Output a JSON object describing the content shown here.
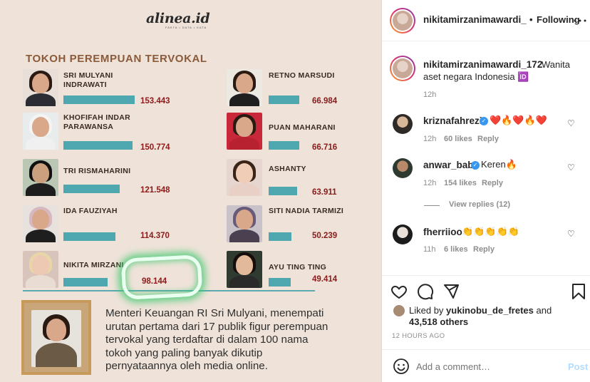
{
  "post_image": {
    "brand": "alinea.id",
    "brand_tagline": "FAKTA • DATA • KATA",
    "headline": "TOKOH PEREMPUAN TERVOKAL",
    "people": [
      {
        "name_line1": "SRI MULYANI",
        "name_line2": "INDRAWATI",
        "value": "153.443"
      },
      {
        "name_line1": "KHOFIFAH INDAR",
        "name_line2": "PARAWANSA",
        "value": "150.774"
      },
      {
        "name_line1": "TRI RISMAHARINI",
        "name_line2": "",
        "value": "121.548"
      },
      {
        "name_line1": "IDA FAUZIYAH",
        "name_line2": "",
        "value": "114.370"
      },
      {
        "name_line1": "NIKITA MIRZANI",
        "name_line2": "",
        "value": "98.144"
      },
      {
        "name_line1": "RETNO MARSUDI",
        "name_line2": "",
        "value": "66.984"
      },
      {
        "name_line1": "PUAN MAHARANI",
        "name_line2": "",
        "value": "66.716"
      },
      {
        "name_line1": "ASHANTY",
        "name_line2": "",
        "value": "63.911"
      },
      {
        "name_line1": "SITI NADIA TARMIZI",
        "name_line2": "",
        "value": "50.239"
      },
      {
        "name_line1": "AYU TING TING",
        "name_line2": "",
        "value": "49.414"
      }
    ],
    "caption": "Menteri Keuangan RI Sri Mulyani, menempati urutan pertama dari 17 publik figur perempuan tervokal yang terdaftar di dalam 100 nama tokoh yang paling banyak dikutip pernyataannya oleh media online."
  },
  "header": {
    "username": "nikitamirzanimawardi_",
    "separator": "•",
    "follow_status": "Following",
    "more_icon": "ellipsis-icon"
  },
  "caption_post": {
    "username": "nikitamirzanimawardi_172",
    "text_line1": "Wanita",
    "text_line2": "aset negara Indonesia 🆔",
    "time": "12h"
  },
  "comments": [
    {
      "username": "kriznafahrezi",
      "verified": true,
      "text": "❤️🔥❤️🔥❤️",
      "time": "12h",
      "likes": "60 likes",
      "reply": "Reply"
    },
    {
      "username": "anwar_bab",
      "verified": true,
      "text": "Keren🔥",
      "time": "12h",
      "likes": "154 likes",
      "reply": "Reply",
      "view_replies": "View replies (12)"
    },
    {
      "username": "fherriioo",
      "verified": false,
      "text": "👏👏👏👏👏",
      "time": "11h",
      "likes": "6 likes",
      "reply": "Reply"
    }
  ],
  "actions": {
    "like_icon": "heart-icon",
    "comment_icon": "comment-icon",
    "share_icon": "share-icon",
    "save_icon": "bookmark-icon"
  },
  "likes": {
    "prefix": "Liked by",
    "liker": "yukinobu_de_fretes",
    "and": "and",
    "others": "43,518 others"
  },
  "posted": "12 HOURS AGO",
  "add_comment": {
    "placeholder": "Add a comment…",
    "post_label": "Post",
    "emoji_icon": "smiley-icon"
  },
  "colors": {
    "bar": "#4fa7b0",
    "value": "#8b1a1a",
    "headline": "#8a5a3a",
    "link_blue": "#0095f6",
    "glow_green": "#3cc86e"
  }
}
